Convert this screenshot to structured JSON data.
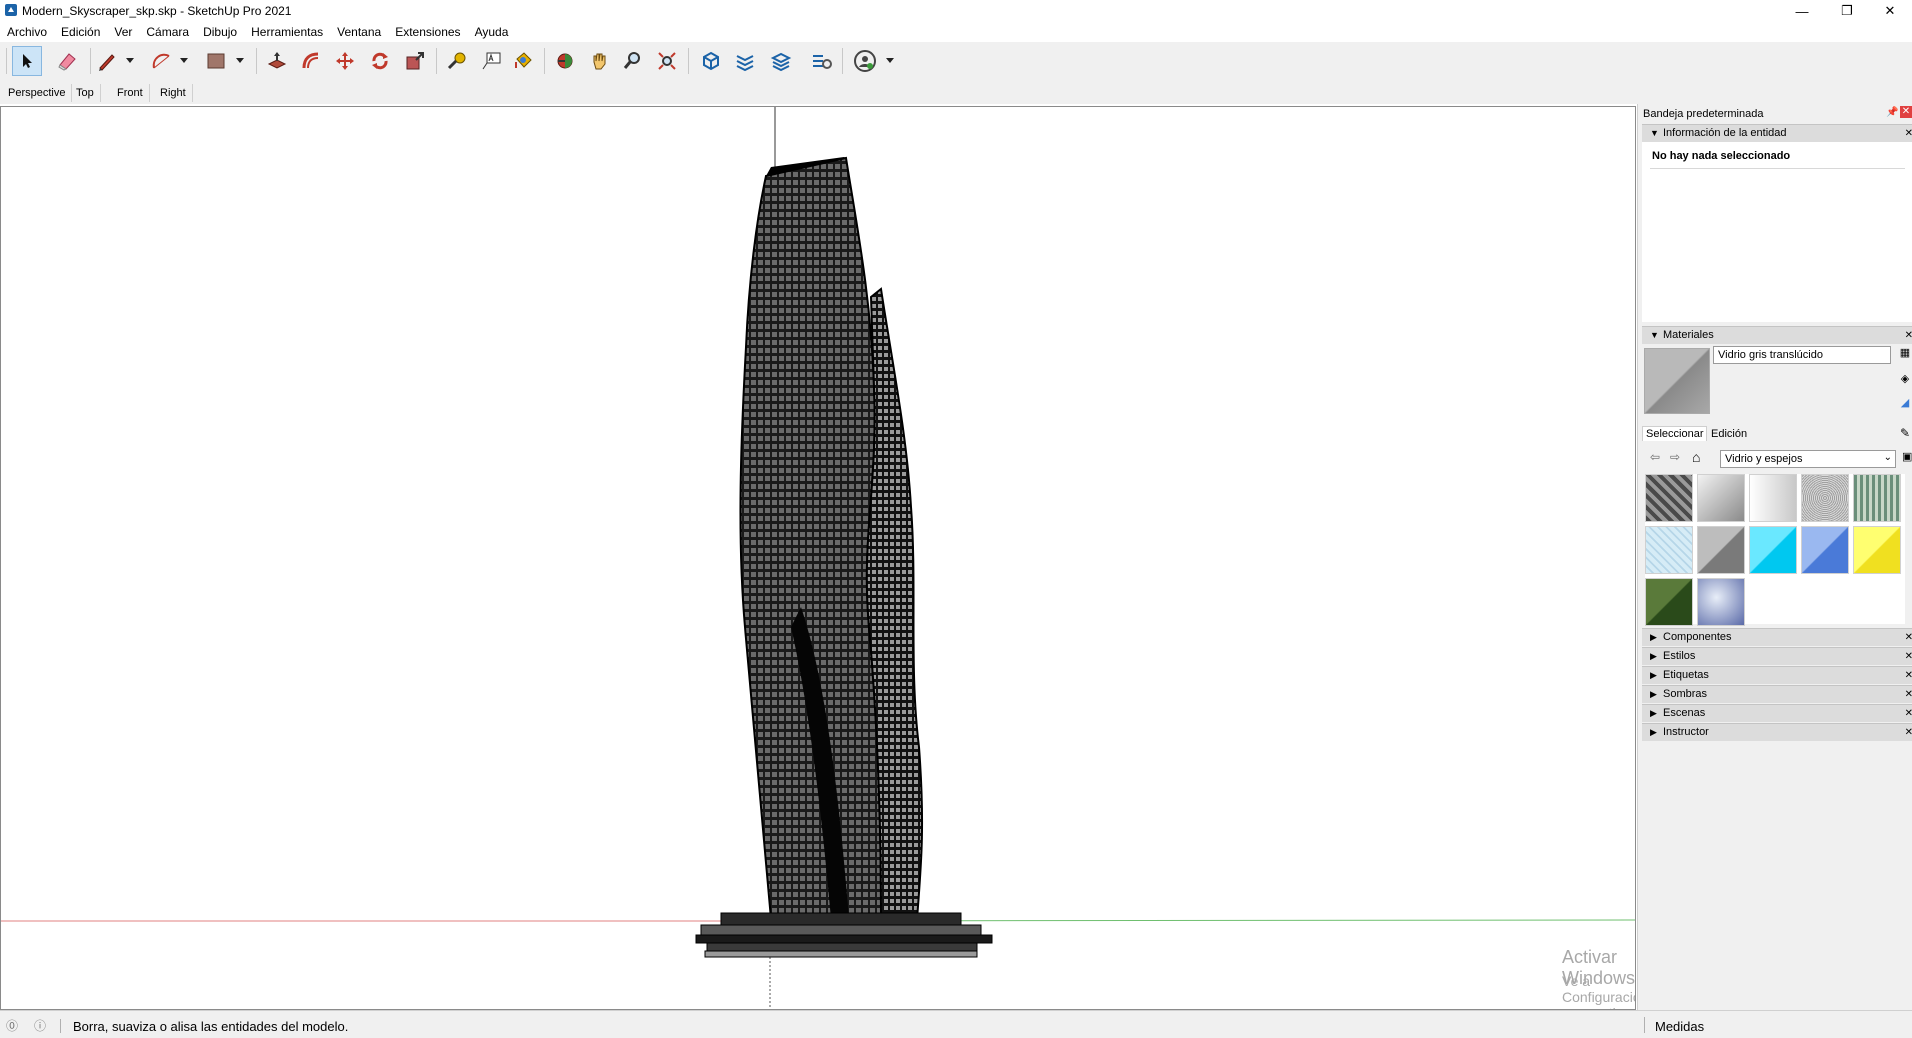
{
  "window": {
    "title": "Modern_Skyscraper_skp.skp - SketchUp Pro 2021",
    "minimize": "—",
    "restore": "❐",
    "close": "✕"
  },
  "menu": [
    "Archivo",
    "Edición",
    "Ver",
    "Cámara",
    "Dibujo",
    "Herramientas",
    "Ventana",
    "Extensiones",
    "Ayuda"
  ],
  "toolbar": {
    "icons": [
      "select-icon",
      "eraser-icon",
      "pencil-icon",
      "arc-icon",
      "rectangle-icon",
      "push-pull-icon",
      "offset-icon",
      "move-icon",
      "rotate-icon",
      "scale-icon",
      "tape-measure-icon",
      "text-icon",
      "paint-bucket-icon",
      "orbit-icon",
      "pan-icon",
      "zoom-icon",
      "zoom-extents-icon",
      "warehouse-icon",
      "extension-icon",
      "layout-icon",
      "profile-icon",
      "account-icon"
    ]
  },
  "scenes": [
    "Perspective",
    "Top",
    "Front",
    "Right"
  ],
  "viewport": {
    "watermark_title": "Activar Windows",
    "watermark_sub": "Ve a Configuración para activar Windows."
  },
  "tray": {
    "title": "Bandeja predeterminada",
    "entity_info": {
      "header": "Información de la entidad",
      "message": "No hay nada seleccionado"
    },
    "materials": {
      "header": "Materiales",
      "current_name": "Vidrio gris translúcido",
      "tabs": [
        "Seleccionar",
        "Edición"
      ],
      "library": "Vidrio y espejos"
    },
    "collapsed_panels": [
      "Componentes",
      "Estilos",
      "Etiquetas",
      "Sombras",
      "Escenas",
      "Instructor"
    ]
  },
  "statusbar": {
    "text": "Borra, suaviza o alisa las entidades del modelo.",
    "measures_label": "Medidas"
  },
  "colors": {
    "accent": "#cce4f7",
    "axis_red": "#e08080",
    "axis_green": "#6fbf6f"
  }
}
